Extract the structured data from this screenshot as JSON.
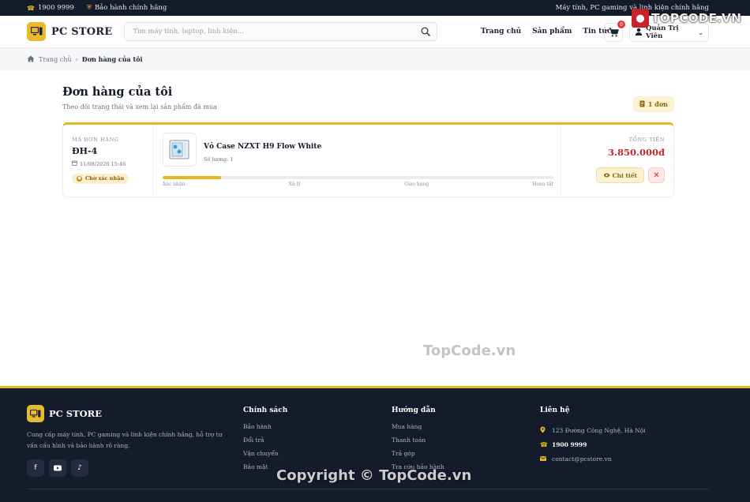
{
  "topbar": {
    "phone": "1900 9999",
    "warranty": "Bảo hành chính hãng",
    "tagline": "Máy tính, PC gaming và linh kiện chính hãng"
  },
  "header": {
    "brand": "PC STORE",
    "search_placeholder": "Tìm máy tính, laptop, linh kiện...",
    "nav": [
      "Trang chủ",
      "Sản phẩm",
      "Tin tức"
    ],
    "cart_count": "0",
    "user_name": "Quản Trị Viên"
  },
  "breadcrumb": {
    "home": "Trang chủ",
    "current": "Đơn hàng của tôi"
  },
  "page": {
    "title": "Đơn hàng của tôi",
    "subtitle": "Theo dõi trạng thái và xem lại sản phẩm đã mua",
    "count_label": "1 đơn"
  },
  "orders": [
    {
      "id_label": "MÃ ĐƠN HÀNG",
      "id": "ĐH-4",
      "date": "11/08/2026 15:46",
      "status": "Chờ xác nhận",
      "item_name": "Vỏ Case NZXT H9 Flow White",
      "quantity": "Số lượng: 1",
      "progress_fraction": 0.15,
      "steps": [
        "Xác nhận",
        "Xử lý",
        "Giao hàng",
        "Hoàn tất"
      ],
      "total_label": "TỔNG TIỀN",
      "total": "3.850.000đ",
      "detail_label": "Chi tiết",
      "cancel_label": "✕"
    }
  ],
  "footer": {
    "brand": "PC STORE",
    "description": "Cung cấp máy tính, PC gaming và linh kiện chính hãng, hỗ trợ tư vấn cấu hình và bảo hành rõ ràng.",
    "social": [
      "facebook-icon",
      "youtube-icon",
      "tiktok-icon"
    ],
    "policy": {
      "title": "Chính sách",
      "links": [
        "Bảo hành",
        "Đổi trả",
        "Vận chuyển",
        "Bảo mật"
      ]
    },
    "guide": {
      "title": "Hướng dẫn",
      "links": [
        "Mua hàng",
        "Thanh toán",
        "Trả góp",
        "Tra cứu bảo hành"
      ]
    },
    "contact": {
      "title": "Liên hệ",
      "address": "123 Đường Công Nghệ, Hà Nội",
      "phone": "1900 9999",
      "email": "contact@pcstore.vn"
    }
  },
  "watermarks": {
    "logo": "TOPCODE.VN",
    "center": "TopCode.vn",
    "copyright": "Copyright © TopCode.vn"
  },
  "colors": {
    "accent": "#e6b720",
    "dark": "#141b2b",
    "price": "#c0272d",
    "cancel": "#d12b2b"
  }
}
